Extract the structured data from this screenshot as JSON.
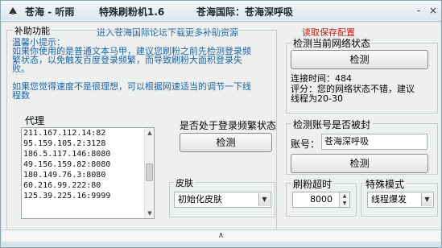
{
  "title": {
    "app_name": "苍海 - 听雨",
    "software": "特殊刷粉机1.6",
    "org": "苍海国际：苍海深呼吸",
    "minimize": "-",
    "close": "×"
  },
  "header_link": "进入苍海国际论坛下载更多补助资源",
  "read_config": "读取保存配置",
  "aux": {
    "group_title": "补助功能",
    "tip_lines": [
      "温馨小提示：",
      "如果你使用的是普通文本马甲，建议您刷粉之前先检测登录频",
      "繁状态，以免触发百度登录频繁，而导致刷粉大面积登录失",
      "败。",
      "",
      "如果您觉得速度不是很理想，可以根据网速适当的调节一下线",
      "程数"
    ],
    "proxy_label": "代理",
    "proxies": [
      "211.167.112.14:82",
      "95.159.105.2:3128",
      "186.5.117.146:8080",
      "49.156.159.82:8080",
      "180.149.76.3:8080",
      "60.216.99.222:80",
      "125.39.225.16:9999"
    ],
    "login_freq_label": "是否处于登录频繁状态",
    "login_freq_button": "检测",
    "skin_label": "皮肤",
    "skin_value": "初始化皮肤"
  },
  "network": {
    "group_title": "检测当前网络状态",
    "button": "检测",
    "connect_time_label": "连接时间：",
    "connect_time_value": "484",
    "score_line1": "评分：您的网络状态不错，建议",
    "score_line2": "线程为20-30"
  },
  "account": {
    "group_title": "检测账号是否被封",
    "account_label": "账号：",
    "account_value": "苍海深呼吸",
    "button": "检测"
  },
  "timeout": {
    "label": "刷粉超时",
    "value": "8000"
  },
  "special": {
    "label": "特殊模式",
    "value": "线程爆发"
  },
  "bottom_toggle": "∧"
}
